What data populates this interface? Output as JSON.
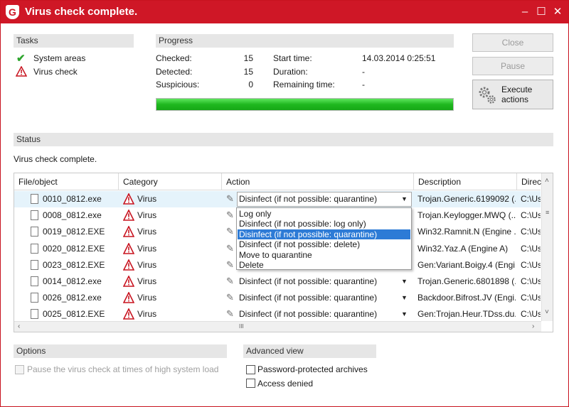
{
  "window": {
    "title": "Virus check complete.",
    "logo": "G",
    "controls": {
      "minimize": "–",
      "maximize": "☐",
      "close": "✕"
    }
  },
  "tasks": {
    "header": "Tasks",
    "items": [
      {
        "label": "System areas",
        "icon": "checkmark-icon"
      },
      {
        "label": "Virus check",
        "icon": "warning-icon"
      }
    ]
  },
  "progress": {
    "header": "Progress",
    "checked_label": "Checked:",
    "checked_value": "15",
    "detected_label": "Detected:",
    "detected_value": "15",
    "suspicious_label": "Suspicious:",
    "suspicious_value": "0",
    "start_label": "Start time:",
    "start_value": "14.03.2014 0:25:51",
    "duration_label": "Duration:",
    "duration_value": "-",
    "remaining_label": "Remaining time:",
    "remaining_value": "-",
    "fraction": 1.0
  },
  "buttons": {
    "close": "Close",
    "pause": "Pause",
    "execute_line1": "Execute",
    "execute_line2": "actions"
  },
  "status": {
    "header": "Status",
    "message": "Virus check complete."
  },
  "grid": {
    "columns": [
      "File/object",
      "Category",
      "Action",
      "Description",
      "Direct"
    ],
    "rows": [
      {
        "file": "0010_0812.exe",
        "category": "Virus",
        "action": "Disinfect (if not possible: quarantine)",
        "description": "Trojan.Generic.6199092 (...",
        "directory": "C:\\Us"
      },
      {
        "file": "0008_0812.exe",
        "category": "Virus",
        "action": "",
        "description": "Trojan.Keylogger.MWQ (...",
        "directory": "C:\\Us"
      },
      {
        "file": "0019_0812.EXE",
        "category": "Virus",
        "action": "",
        "description": "Win32.Ramnit.N (Engine ...",
        "directory": "C:\\Us"
      },
      {
        "file": "0020_0812.EXE",
        "category": "Virus",
        "action": "",
        "description": "Win32.Yaz.A (Engine A)",
        "directory": "C:\\Us"
      },
      {
        "file": "0023_0812.EXE",
        "category": "Virus",
        "action": "",
        "description": "Gen:Variant.Boigy.4 (Engi...",
        "directory": "C:\\Us"
      },
      {
        "file": "0014_0812.exe",
        "category": "Virus",
        "action": "Disinfect (if not possible: quarantine)",
        "description": "Trojan.Generic.6801898 (...",
        "directory": "C:\\Us"
      },
      {
        "file": "0026_0812.exe",
        "category": "Virus",
        "action": "Disinfect (if not possible: quarantine)",
        "description": "Backdoor.Bifrost.JV (Engi...",
        "directory": "C:\\Us"
      },
      {
        "file": "0025_0812.EXE",
        "category": "Virus",
        "action": "Disinfect (if not possible: quarantine)",
        "description": "Gen:Trojan.Heur.TDss.du...",
        "directory": "C:\\Us"
      }
    ],
    "dropdown_options": [
      "Log only",
      "Disinfect (if not possible: log only)",
      "Disinfect (if not possible: quarantine)",
      "Disinfect (if not possible: delete)",
      "Move to quarantine",
      "Delete"
    ],
    "dropdown_selected": "Disinfect (if not possible: quarantine)",
    "hscroll_grip": "III"
  },
  "options": {
    "header": "Options",
    "pause_label": "Pause the virus check at times of high system load"
  },
  "advanced": {
    "header": "Advanced view",
    "items": [
      "Password-protected archives",
      "Access denied"
    ]
  },
  "colors": {
    "titlebar": "#cf1726",
    "progress": "#1fb81f",
    "highlight": "#2d7bd6"
  }
}
